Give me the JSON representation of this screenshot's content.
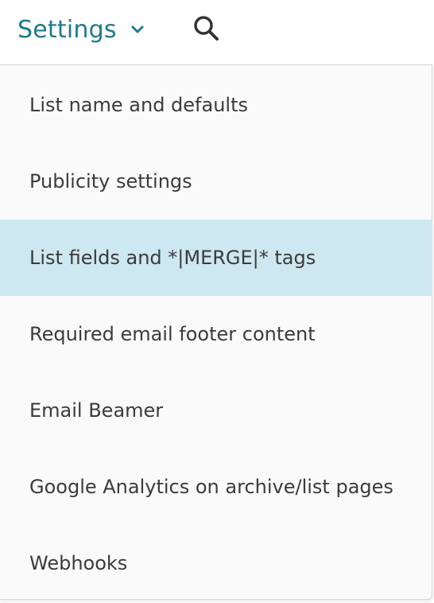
{
  "header": {
    "settings_label": "Settings",
    "chevron_icon": "chevron-down-icon",
    "search_icon": "search-icon",
    "accent_color": "#1f7a8c"
  },
  "menu": {
    "items": [
      {
        "label": "List name and defaults",
        "active": false
      },
      {
        "label": "Publicity settings",
        "active": false
      },
      {
        "label": "List fields and *|MERGE|* tags",
        "active": true
      },
      {
        "label": "Required email footer content",
        "active": false
      },
      {
        "label": "Email Beamer",
        "active": false
      },
      {
        "label": "Google Analytics on archive/list pages",
        "active": false
      },
      {
        "label": "Webhooks",
        "active": false
      }
    ],
    "highlight_color": "#cde8f0"
  }
}
